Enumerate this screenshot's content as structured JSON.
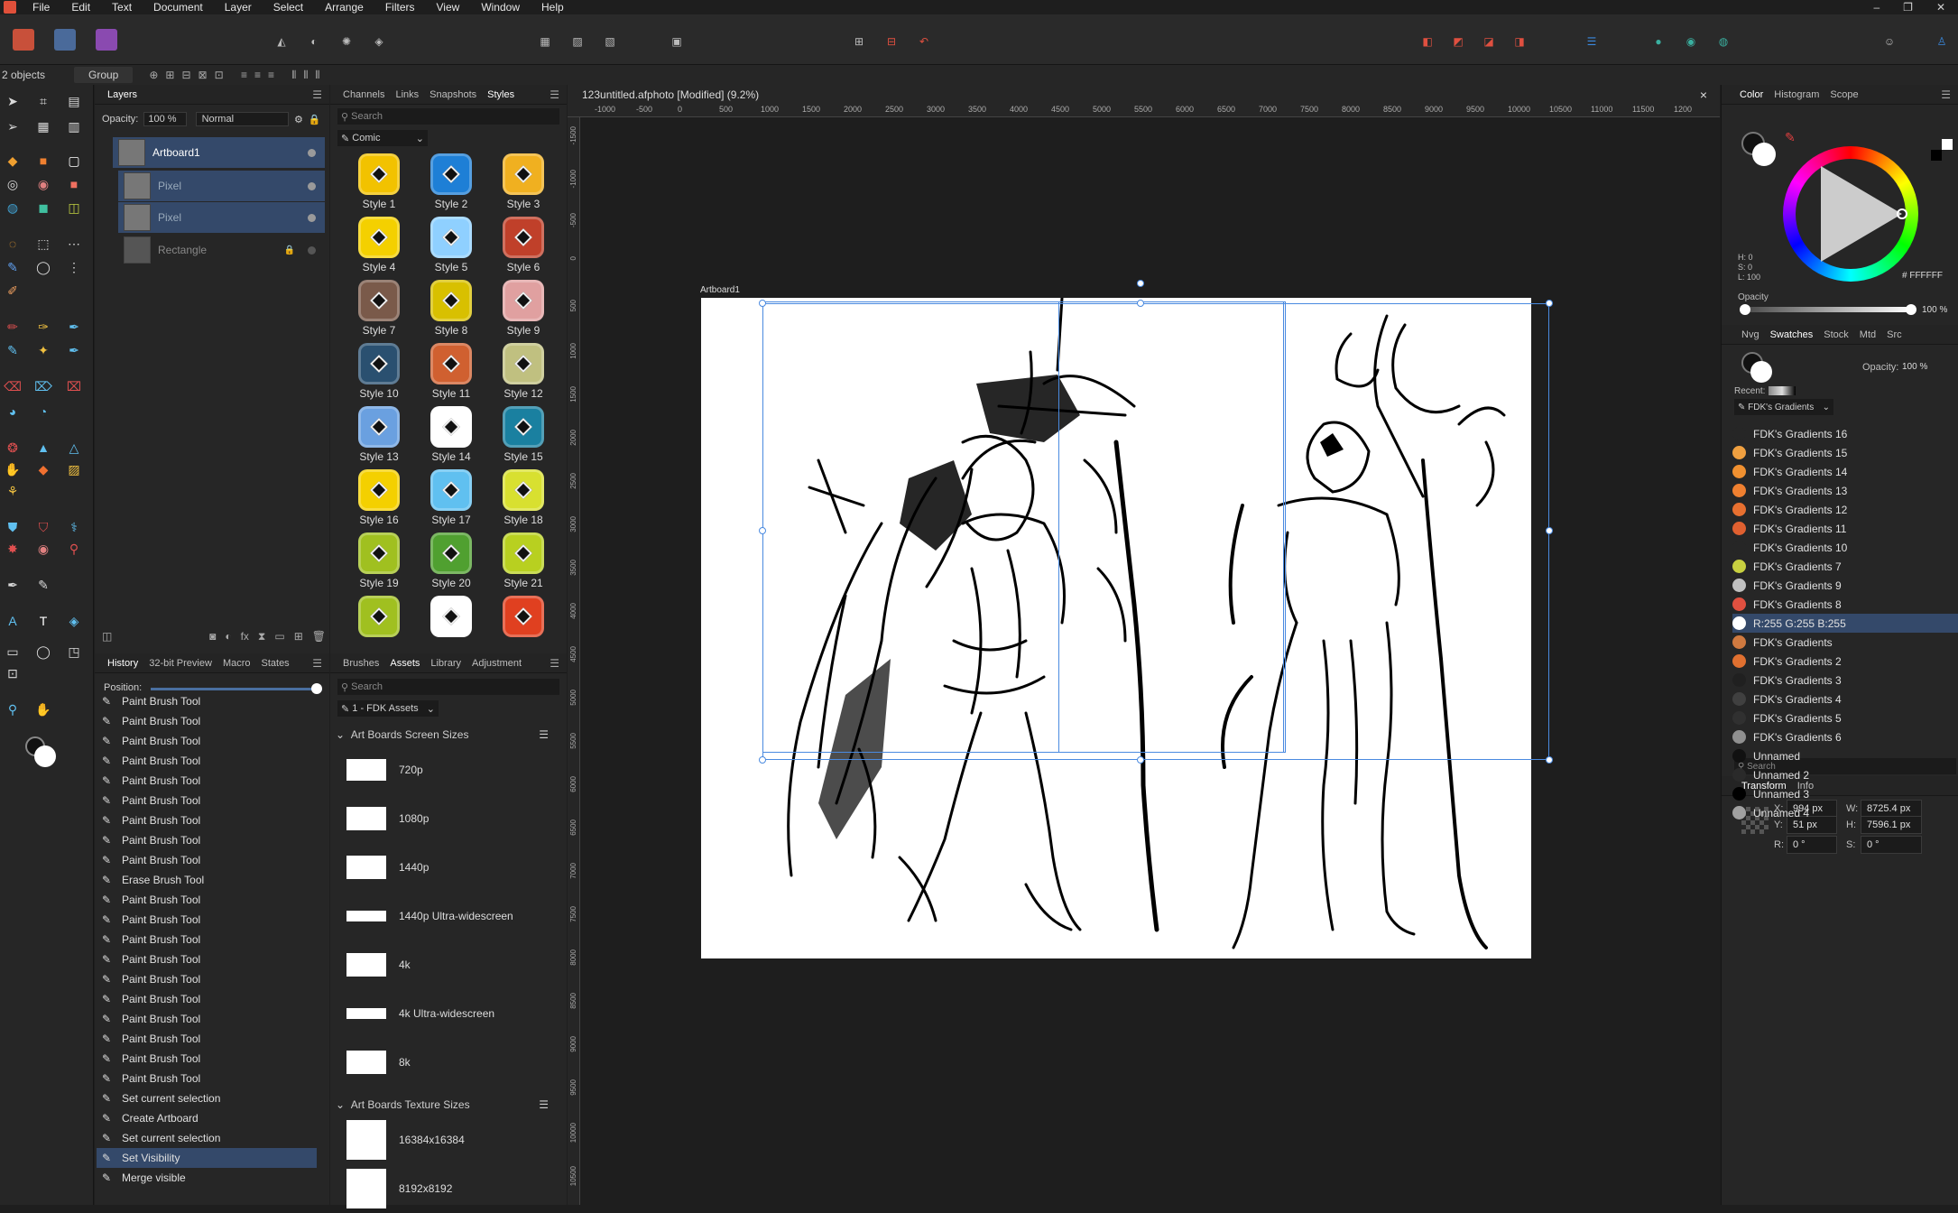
{
  "menu": {
    "items": [
      "File",
      "Edit",
      "Text",
      "Document",
      "Layer",
      "Select",
      "Arrange",
      "Filters",
      "View",
      "Window",
      "Help"
    ]
  },
  "context": {
    "selection": "2 objects",
    "group_label": "Group"
  },
  "layers": {
    "tabs": [
      "Layers"
    ],
    "opacity_label": "Opacity:",
    "opacity_value": "100 %",
    "blend_mode": "Normal",
    "items": [
      {
        "name": "Artboard1"
      },
      {
        "name": "Pixel"
      },
      {
        "name": "Pixel"
      },
      {
        "name": "Rectangle"
      }
    ]
  },
  "styles": {
    "tabs": [
      "Channels",
      "Links",
      "Snapshots",
      "Styles"
    ],
    "search_placeholder": "Search",
    "category": "Comic",
    "items": [
      {
        "name": "Style 1",
        "color": "#f2c200"
      },
      {
        "name": "Style 2",
        "color": "#1e7fd6"
      },
      {
        "name": "Style 3",
        "color": "#f0b020"
      },
      {
        "name": "Style 4",
        "color": "#f4d000"
      },
      {
        "name": "Style 5",
        "color": "#8fd0ff"
      },
      {
        "name": "Style 6",
        "color": "#c0402a"
      },
      {
        "name": "Style 7",
        "color": "#7a5a4a"
      },
      {
        "name": "Style 8",
        "color": "#d8c000"
      },
      {
        "name": "Style 9",
        "color": "#e0a0a0"
      },
      {
        "name": "Style 10",
        "color": "#2a5070"
      },
      {
        "name": "Style 11",
        "color": "#d06030"
      },
      {
        "name": "Style 12",
        "color": "#c0c080"
      },
      {
        "name": "Style 13",
        "color": "#6aa0e0"
      },
      {
        "name": "Style 14",
        "color": "#ffffff"
      },
      {
        "name": "Style 15",
        "color": "#1a80a0"
      },
      {
        "name": "Style 16",
        "color": "#f4d000"
      },
      {
        "name": "Style 17",
        "color": "#60c0f0"
      },
      {
        "name": "Style 18",
        "color": "#d8e030"
      },
      {
        "name": "Style 19",
        "color": "#a0c020"
      },
      {
        "name": "Style 20",
        "color": "#50a030"
      },
      {
        "name": "Style 21",
        "color": "#b8d020"
      },
      {
        "name": "",
        "color": "#a0c020"
      },
      {
        "name": "",
        "color": "#ffffff"
      },
      {
        "name": "",
        "color": "#e04020"
      }
    ]
  },
  "history": {
    "tabs": [
      "History",
      "32-bit Preview",
      "Macro",
      "States"
    ],
    "position_label": "Position:",
    "items": [
      "Paint Brush Tool",
      "Paint Brush Tool",
      "Paint Brush Tool",
      "Paint Brush Tool",
      "Paint Brush Tool",
      "Paint Brush Tool",
      "Paint Brush Tool",
      "Paint Brush Tool",
      "Paint Brush Tool",
      "Erase Brush Tool",
      "Paint Brush Tool",
      "Paint Brush Tool",
      "Paint Brush Tool",
      "Paint Brush Tool",
      "Paint Brush Tool",
      "Paint Brush Tool",
      "Paint Brush Tool",
      "Paint Brush Tool",
      "Paint Brush Tool",
      "Paint Brush Tool",
      "Set current selection",
      "Create Artboard",
      "Set current selection",
      "Set Visibility",
      "Merge visible"
    ]
  },
  "assets": {
    "tabs": [
      "Brushes",
      "Assets",
      "Library",
      "Adjustment"
    ],
    "search_placeholder": "Search",
    "category": "1 - FDK Assets",
    "group1": "Art Boards Screen Sizes",
    "group1_items": [
      "720p",
      "1080p",
      "1440p",
      "1440p Ultra-widescreen",
      "4k",
      "4k Ultra-widescreen",
      "8k"
    ],
    "group2": "Art Boards Texture Sizes",
    "group2_items": [
      "16384x16384",
      "8192x8192"
    ]
  },
  "document": {
    "title": "123untitled.afphoto [Modified] (9.2%)",
    "close": "×",
    "artboard_label": "Artboard1",
    "ruler_labels": [
      "-1000",
      "-500",
      "0",
      "500",
      "1000",
      "1500",
      "2000",
      "2500",
      "3000",
      "3500",
      "4000",
      "4500",
      "5000",
      "5500",
      "6000",
      "6500",
      "7000",
      "7500",
      "8000",
      "8500",
      "9000",
      "9500",
      "10000",
      "10500",
      "11000",
      "11500",
      "1200"
    ],
    "vruler_labels": [
      "-1500",
      "-1000",
      "-500",
      "0",
      "500",
      "1000",
      "1500",
      "2000",
      "2500",
      "3000",
      "3500",
      "4000",
      "4500",
      "5000",
      "5500",
      "6000",
      "6500",
      "7000",
      "7500",
      "8000",
      "8500",
      "9000",
      "9500",
      "10000",
      "10500"
    ]
  },
  "color": {
    "tabs": [
      "Color",
      "Histogram",
      "Scope"
    ],
    "hsl": [
      "H: 0",
      "S: 0",
      "L: 100"
    ],
    "hex": "# FFFFFF",
    "opacity_label": "Opacity",
    "opacity_value": "100 %"
  },
  "swatches": {
    "tabs": [
      "Nvg",
      "Swatches",
      "Stock",
      "Mtd",
      "Src"
    ],
    "opacity_label": "Opacity:",
    "opacity_value": "100 %",
    "recent_label": "Recent:",
    "palette": "FDK's Gradients",
    "items": [
      {
        "name": "FDK's Gradients 16",
        "color": "#262626"
      },
      {
        "name": "FDK's Gradients 15",
        "color": "#f0a040"
      },
      {
        "name": "FDK's Gradients 14",
        "color": "#f09030"
      },
      {
        "name": "FDK's Gradients 13",
        "color": "#f08030"
      },
      {
        "name": "FDK's Gradients 12",
        "color": "#e87030"
      },
      {
        "name": "FDK's Gradients 11",
        "color": "#e06030"
      },
      {
        "name": "FDK's Gradients 10",
        "color": "#262626"
      },
      {
        "name": "FDK's Gradients 7",
        "color": "#c8d040"
      },
      {
        "name": "FDK's Gradients 9",
        "color": "#c0c0c0"
      },
      {
        "name": "FDK's Gradients 8",
        "color": "#e05040"
      },
      {
        "name": "R:255 G:255 B:255",
        "color": "#ffffff"
      },
      {
        "name": "FDK's Gradients",
        "color": "#d07a40"
      },
      {
        "name": "FDK's Gradients 2",
        "color": "#e07030"
      },
      {
        "name": "FDK's Gradients 3",
        "color": "#202020"
      },
      {
        "name": "FDK's Gradients 4",
        "color": "#404040"
      },
      {
        "name": "FDK's Gradients 5",
        "color": "#303030"
      },
      {
        "name": "FDK's Gradients 6",
        "color": "#909090"
      },
      {
        "name": "Unnamed",
        "color": "#111111"
      },
      {
        "name": "Unnamed 2",
        "color": "#2a2a2a"
      },
      {
        "name": "Unnamed 3",
        "color": "#000000"
      },
      {
        "name": "Unnamed 4",
        "color": "#a0a0a0"
      }
    ],
    "search_placeholder": "Search"
  },
  "transform": {
    "tabs": [
      "Transform",
      "Info"
    ],
    "x_label": "X:",
    "x": "994 px",
    "y_label": "Y:",
    "y": "51 px",
    "w_label": "W:",
    "w": "8725.4 px",
    "h_label": "H:",
    "h": "7596.1 px",
    "r_label": "R:",
    "r": "0 °",
    "s_label": "S:",
    "s": "0 °"
  }
}
